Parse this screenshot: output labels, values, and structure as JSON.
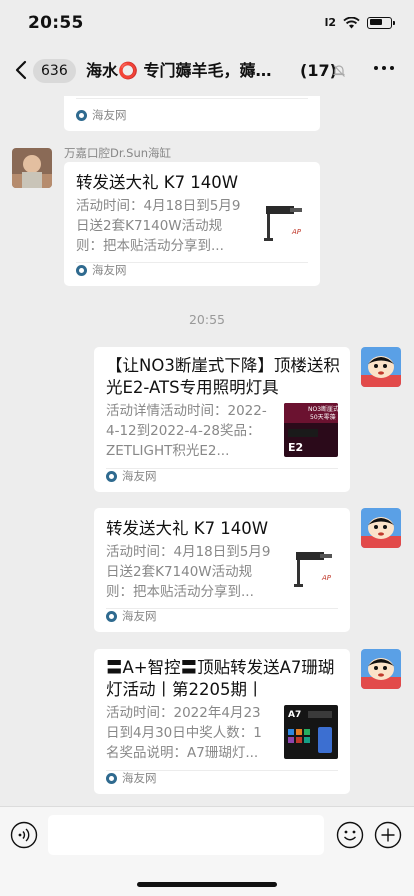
{
  "status": {
    "time": "20:55",
    "signal": "l2"
  },
  "header": {
    "unread": "636",
    "title": "海水⭕ 专门薅羊毛，薅…",
    "member_count": "(17)"
  },
  "messages": [
    {
      "source": "海友网"
    },
    {
      "sender": "万嘉口腔Dr.Sun海缸",
      "title": "转发送大礼 K7 140W",
      "desc": "活动时间：4月18日到5月9日送2套K7140W活动规则：把本贴活动分享到...",
      "source": "海友网"
    },
    {
      "timestamp": "20:55"
    },
    {
      "title": "【让NO3断崖式下降】顶楼送积光E2-ATS专用照明灯具",
      "desc": "活动详情活动时间：2022-4-12到2022-4-28奖品：ZETLIGHT积光E2...",
      "thumb_text": {
        "line1": "NO3断崖式",
        "line2": "50天零藻",
        "model": "E2"
      },
      "source": "海友网"
    },
    {
      "title": "转发送大礼 K7 140W",
      "desc": "活动时间：4月18日到5月9日送2套K7140W活动规则：把本贴活动分享到...",
      "source": "海友网"
    },
    {
      "title": "〓A+智控〓顶贴转发送A7珊瑚灯活动丨第2205期丨",
      "desc": "活动时间：2022年4月23日到4月30日中奖人数：1名奖品说明：A7珊瑚灯...",
      "thumb_text": {
        "model": "A7"
      },
      "source": "海友网"
    }
  ],
  "colors": {
    "background": "#ededed",
    "card": "#ffffff",
    "secondary_text": "#888888",
    "source_icon": "#2f6a8f"
  },
  "icons": [
    "back-chevron-icon",
    "mute-icon",
    "more-icon",
    "voice-icon",
    "emoji-icon",
    "plus-icon"
  ]
}
